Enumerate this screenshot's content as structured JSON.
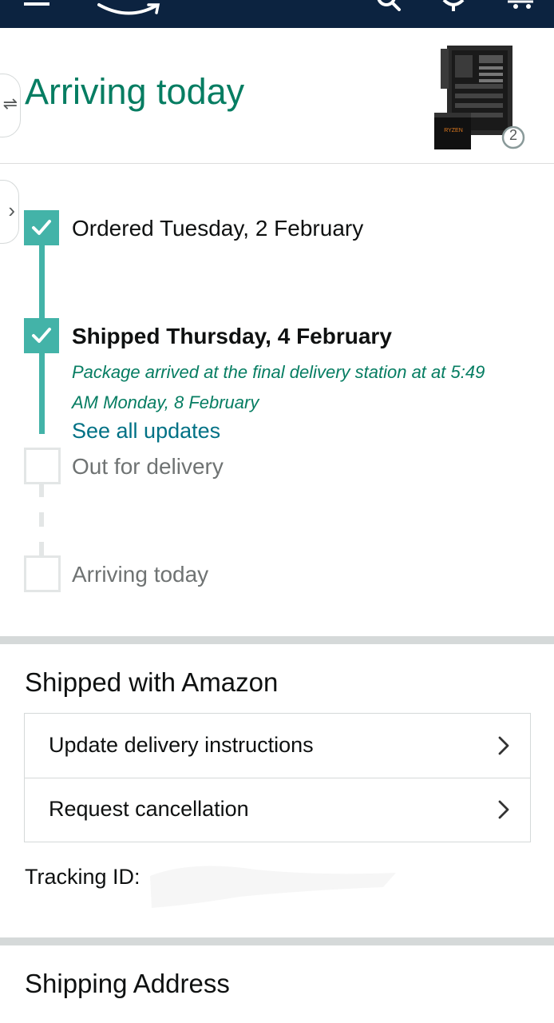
{
  "header": {
    "arriving_title": "Arriving today",
    "item_count": "2"
  },
  "timeline": {
    "steps": [
      {
        "label": "Ordered Tuesday, 2 February",
        "done": true
      },
      {
        "label": "Shipped Thursday, 4 February",
        "done": true,
        "detail_line1": "Package arrived at the final delivery station at at 5:49",
        "detail_line2": "AM Monday, 8 February"
      },
      {
        "label": "Out for delivery",
        "done": false
      },
      {
        "label": "Arriving today",
        "done": false
      }
    ],
    "see_all_updates": "See all updates"
  },
  "shipped_with": {
    "title": "Shipped with Amazon",
    "actions": [
      {
        "label": "Update delivery instructions"
      },
      {
        "label": "Request cancellation"
      }
    ],
    "tracking_label": "Tracking ID:"
  },
  "shipping_address": {
    "title": "Shipping Address"
  },
  "colors": {
    "nav_bg": "#0c2340",
    "accent_green": "#067d62",
    "timeline_teal": "#43b3a8",
    "link_teal": "#007185",
    "divider": "#d5d9d9"
  },
  "icons": [
    "menu-icon",
    "amazon-smile-logo",
    "search-icon",
    "location-icon",
    "cart-icon",
    "swap-icon",
    "chevron-right-icon",
    "checkmark-icon"
  ]
}
